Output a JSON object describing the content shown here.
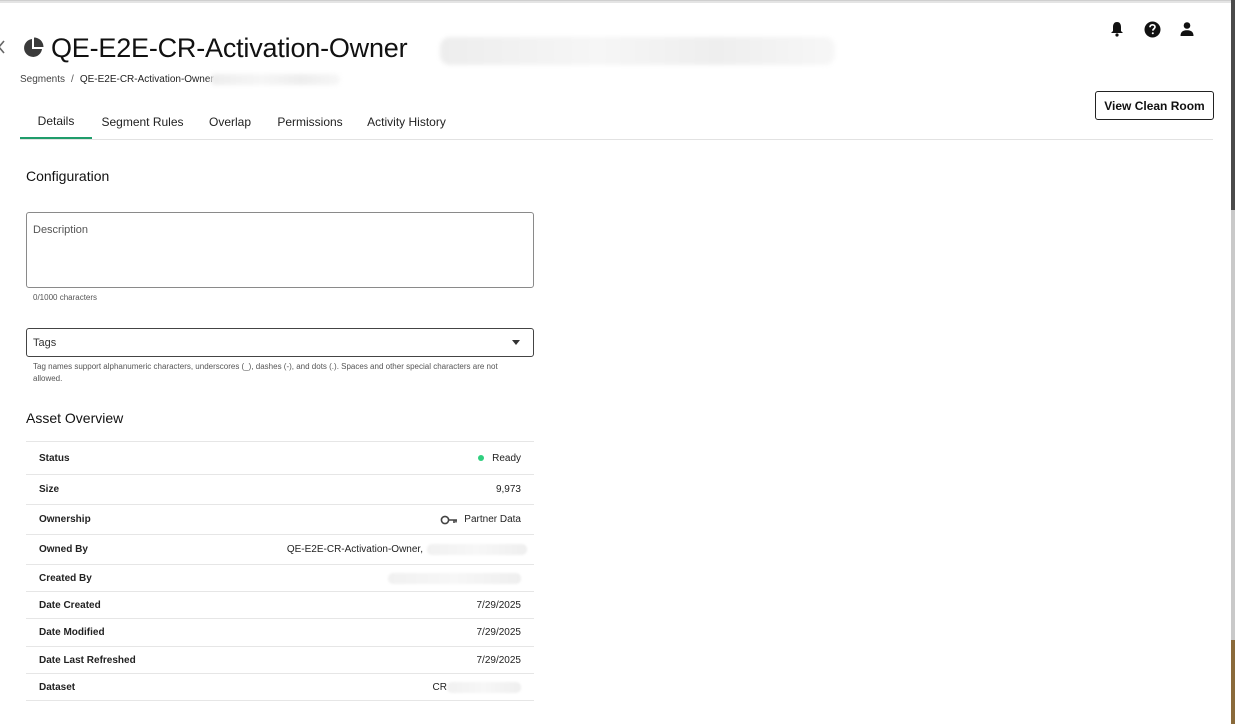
{
  "header": {
    "title": "QE-E2E-CR-Activation-Owner",
    "title_icon": "pie-chart-icon",
    "icons": [
      "bell-icon",
      "help-icon",
      "user-icon"
    ]
  },
  "breadcrumb": {
    "root": "Segments",
    "separator": "/",
    "current": "QE-E2E-CR-Activation-Owner"
  },
  "actions": {
    "view_clean_room": "View Clean Room"
  },
  "tabs": [
    {
      "label": "Details",
      "active": true
    },
    {
      "label": "Segment Rules",
      "active": false
    },
    {
      "label": "Overlap",
      "active": false
    },
    {
      "label": "Permissions",
      "active": false
    },
    {
      "label": "Activity History",
      "active": false
    }
  ],
  "configuration": {
    "title": "Configuration",
    "description_placeholder": "Description",
    "char_count": "0/1000 characters",
    "tags_placeholder": "Tags",
    "tags_helper": "Tag names support alphanumeric characters, underscores (_), dashes (-), and dots (.). Spaces and other special characters are not allowed."
  },
  "asset_overview": {
    "title": "Asset Overview",
    "rows": [
      {
        "label": "Status",
        "value": "Ready"
      },
      {
        "label": "Size",
        "value": "9,973"
      },
      {
        "label": "Ownership",
        "value": "Partner Data"
      },
      {
        "label": "Owned By",
        "value": "QE-E2E-CR-Activation-Owner,"
      },
      {
        "label": "Created By",
        "value": ""
      },
      {
        "label": "Date Created",
        "value": "7/29/2025"
      },
      {
        "label": "Date Modified",
        "value": "7/29/2025"
      },
      {
        "label": "Date Last Refreshed",
        "value": "7/29/2025"
      },
      {
        "label": "Dataset",
        "value": "CR"
      }
    ]
  },
  "colors": {
    "active_tab": "#1f9d6b",
    "status_ready": "#2fcf7f"
  }
}
